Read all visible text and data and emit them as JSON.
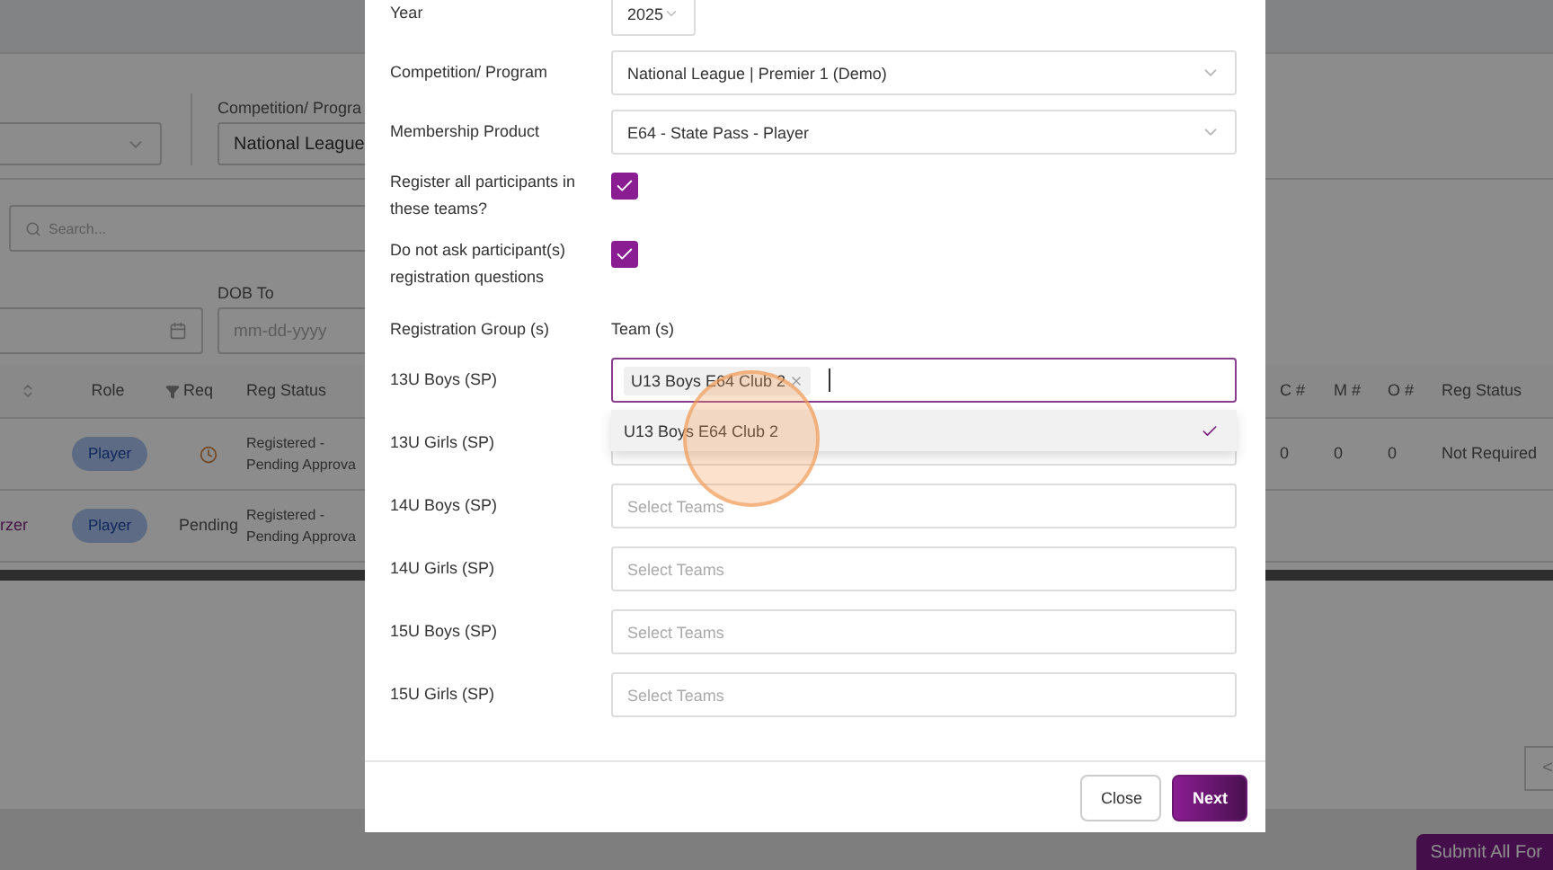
{
  "background": {
    "competition_label": "Competition/ Progra",
    "competition_value": "National League",
    "search_placeholder": "Search...",
    "dob_to_label": "DOB To",
    "dob_to_placeholder": "mm-dd-yyyy",
    "table": {
      "columns_left": [
        "Role",
        "Req",
        "Reg Status"
      ],
      "columns_right": [
        "C #",
        "M #",
        "O #",
        "Reg Status"
      ],
      "rows": [
        {
          "role": "Player",
          "req": {
            "kind": "clock"
          },
          "status": "Registered - Pending Approva",
          "right_cells": [
            "0",
            "0",
            "0",
            "Not Required"
          ]
        },
        {
          "name": "rzer",
          "role": "Player",
          "req": {
            "kind": "text",
            "text": "Pending"
          },
          "status": "Registered - Pending Approva"
        }
      ]
    },
    "pager_prev": "<",
    "submit_label": "Submit All For"
  },
  "modal": {
    "fields": [
      {
        "kind": "short_select",
        "label": "Year",
        "value": "2025"
      },
      {
        "kind": "select",
        "label": "Competition/ Program",
        "value": "National League | Premier 1 (Demo)"
      },
      {
        "kind": "select",
        "label": "Membership Product",
        "value": "E64 - State Pass - Player"
      },
      {
        "kind": "checkbox",
        "label": "Register all participants in these teams?",
        "checked": true
      },
      {
        "kind": "checkbox",
        "label": "Do not ask participant(s) registration questions",
        "checked": true
      }
    ],
    "group_header": "Registration Group (s)",
    "team_header": "Team (s)",
    "groups": [
      {
        "label": "13U Boys (SP)",
        "tags": [
          "U13 Boys E64 Club 2"
        ],
        "focused": true,
        "dropdown": [
          {
            "label": "U13 Boys E64 Club 2",
            "selected": true
          }
        ]
      },
      {
        "label": "13U Girls (SP)",
        "focused": false
      },
      {
        "label": "14U Boys (SP)",
        "placeholder": "Select Teams",
        "focused": false
      },
      {
        "label": "14U Girls (SP)",
        "placeholder": "Select Teams",
        "focused": false
      },
      {
        "label": "15U Boys (SP)",
        "placeholder": "Select Teams",
        "focused": false
      },
      {
        "label": "15U Girls (SP)",
        "placeholder": "Select Teams",
        "focused": false
      }
    ],
    "buttons": [
      {
        "label": "Close",
        "kind": "secondary"
      },
      {
        "label": "Next",
        "kind": "primary"
      }
    ]
  }
}
